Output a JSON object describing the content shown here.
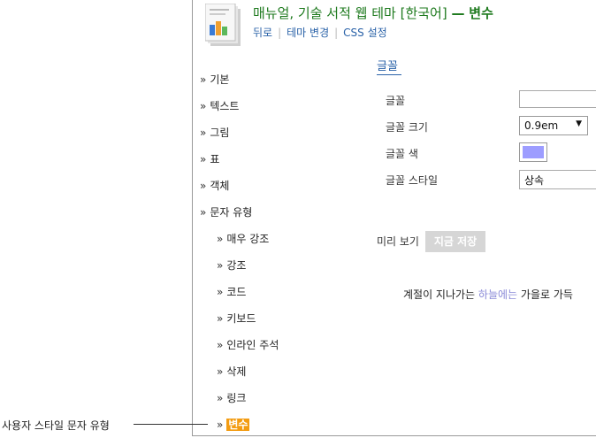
{
  "header": {
    "title": "매뉴얼, 기술 서적 웹 테마 [한국어]",
    "title_sep": "—",
    "title_mode": "변수",
    "links": [
      "뒤로",
      "테마 변경",
      "CSS 설정"
    ]
  },
  "sidebar": {
    "items": [
      {
        "label": "기본"
      },
      {
        "label": "텍스트"
      },
      {
        "label": "그림"
      },
      {
        "label": "표"
      },
      {
        "label": "객체"
      },
      {
        "label": "문자 유형"
      }
    ],
    "subitems": [
      {
        "label": "매우 강조"
      },
      {
        "label": "강조"
      },
      {
        "label": "코드"
      },
      {
        "label": "키보드"
      },
      {
        "label": "인라인 주석"
      },
      {
        "label": "삭제"
      },
      {
        "label": "링크"
      },
      {
        "label": "변수"
      }
    ],
    "bullet": "»"
  },
  "main": {
    "tab": "글꼴",
    "fields": {
      "font_label": "글꼴",
      "font_value": "",
      "size_label": "글꼴 크기",
      "size_value": "0.9em",
      "color_label": "글꼴 색",
      "color_value": "#9d9dff",
      "style_label": "글꼴 스타일",
      "style_value": "상속"
    },
    "preview_label": "미리 보기",
    "save_label": "지금 저장",
    "sample_before": "계절이 지나가는 ",
    "sample_highlight": "하늘에는",
    "sample_after": " 가을로 가득"
  },
  "annotation": {
    "label": "사용자 스타일 문자 유형"
  },
  "colors": {
    "accent": "#f39c12",
    "link": "#2a62a8",
    "title": "#1e7a1e"
  }
}
